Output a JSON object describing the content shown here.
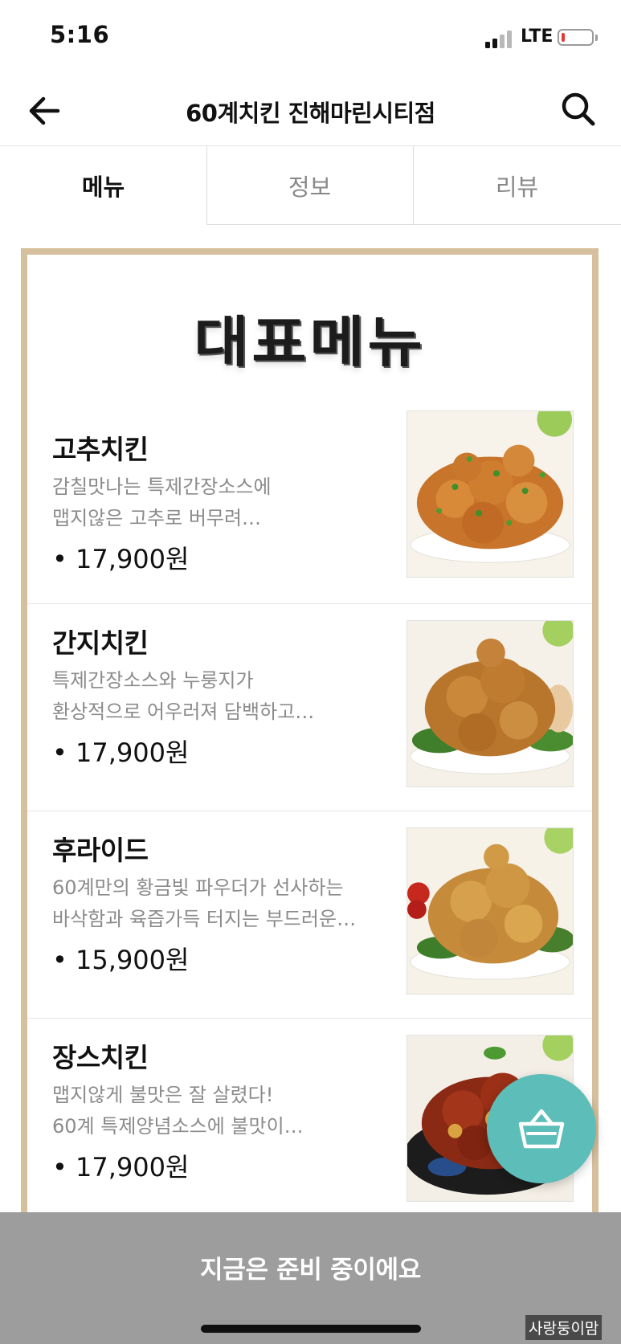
{
  "status_bar": {
    "time": "5:16",
    "network": "LTE",
    "battery_level": 0.12,
    "colors": {
      "battery_low": "#e53935",
      "text": "#111111"
    }
  },
  "header": {
    "back_icon": "arrow-left-icon",
    "title": "60계치킨 진해마린시티점",
    "search_icon": "magnifier-icon"
  },
  "tabs": [
    {
      "label": "메뉴",
      "active": true
    },
    {
      "label": "정보",
      "active": false
    },
    {
      "label": "리뷰",
      "active": false
    }
  ],
  "board": {
    "title": "대표메뉴",
    "frame_color": "#d6bf9c",
    "items": [
      {
        "name": "고추치킨",
        "desc_lines": [
          "감칠맛나는 특제간장소스에",
          "맵지않은 고추로 버무려…"
        ],
        "price": "• 17,900원",
        "photo": "spicy-chicken-photo"
      },
      {
        "name": "간지치킨",
        "desc_lines": [
          "특제간장소스와 누룽지가",
          "환상적으로 어우러져 담백하고…"
        ],
        "price": "• 17,900원",
        "photo": "soy-chicken-photo"
      },
      {
        "name": "후라이드",
        "desc_lines": [
          "60계만의 황금빛 파우더가 선사하는",
          "바삭함과 육즙가득 터지는 부드러운…"
        ],
        "price": "• 15,900원",
        "photo": "fried-chicken-photo"
      },
      {
        "name": "장스치킨",
        "desc_lines": [
          "맵지않게 불맛은 잘 살렸다!",
          "60계 특제양념소스에 불맛이…"
        ],
        "price": "• 17,900원",
        "photo": "fire-chicken-photo"
      }
    ]
  },
  "cart": {
    "icon": "shopping-basket-icon",
    "color": "#5cbdb9"
  },
  "bottom_bar": {
    "label": "지금은 준비 중이에요",
    "watermark": "사랑둥이맘",
    "color": "#9d9d9d"
  }
}
